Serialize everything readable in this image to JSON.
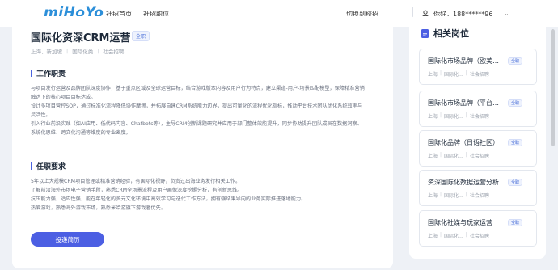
{
  "header": {
    "logo_text": "miHoYo",
    "logo_sub": "TECH OTAKUS SAVE THE WORLD",
    "nav": [
      "社招首页",
      "社招职位"
    ],
    "switch_campus": "切换到校招",
    "user_text": "你好，188******96"
  },
  "job": {
    "title": "国际化资深CRM运营",
    "tag": "全职",
    "meta": [
      "上海、新加坡",
      "国际化类",
      "社会招聘"
    ],
    "sections": [
      {
        "title": "工作职责",
        "lines": [
          "与项目发行运营及品牌团队深度协作，基于重点区域及全球运营目标，结合游戏版本内容及用户行为特点，建立渠道-用户-场景匹配模型，保障精准营销",
          "触达下的核心项目目标达成。",
          "设计多项目营控SOP，通过标准化流程降低协作摩擦，并拓展自建CRM系统能力边界，提出可量化的流程优化指标，推动平台技术团队优化系统效率与",
          "灵活性。",
          "引入行业前沿实践（如AI应用、低代码内容、Chatbots等），主导CRM创新课题研究并应用于部门整体效能提升，同步协助提升团队成员在数据洞察、",
          "系统化思维、跨文化沟通等维度的专业密度。"
        ]
      },
      {
        "title": "任职要求",
        "lines": [
          "5年以上大规模CRM项目管理或精准营销经验，有国际化视野，负责过出海业务发行相关工作。",
          "了解前沿海外市场电子营销手段，熟悉CRM全场景流程及用户画像深度挖掘分析，有创新思维。",
          "抗压能力强，适应性强，能在年轻化的多元文化环境中高效学习与迭代工作方法，拥有强结果导向的业务实际推进落地能力。",
          "热爱游戏，熟悉海外游戏市场，熟悉米哈游旗下游戏者优先。"
        ]
      }
    ],
    "apply_label": "投递简历"
  },
  "related": {
    "title": "相关岗位",
    "items": [
      {
        "title": "国际化市场品牌（欧美方向）",
        "tag": "全职",
        "meta": [
          "上海",
          "国际化...",
          "社会招聘"
        ]
      },
      {
        "title": "国际化市场品牌（平台方向）",
        "tag": "全职",
        "meta": [
          "上海",
          "国际化...",
          "社会招聘"
        ]
      },
      {
        "title": "国际化品牌（日语社区）",
        "tag": "全职",
        "meta": [
          "上海",
          "国际化...",
          "社会招聘"
        ]
      },
      {
        "title": "资深国际化数据运营分析",
        "tag": "全职",
        "meta": [
          "上海",
          "国际化...",
          "社会招聘"
        ]
      },
      {
        "title": "国际化社媒与玩家运营",
        "tag": "全职",
        "meta": [
          "上海",
          "国际化...",
          "社会招聘"
        ]
      }
    ]
  },
  "colors": {
    "accent": "#4c5fe3",
    "logo": "#2c8fd9",
    "background": "#eef1f6"
  }
}
